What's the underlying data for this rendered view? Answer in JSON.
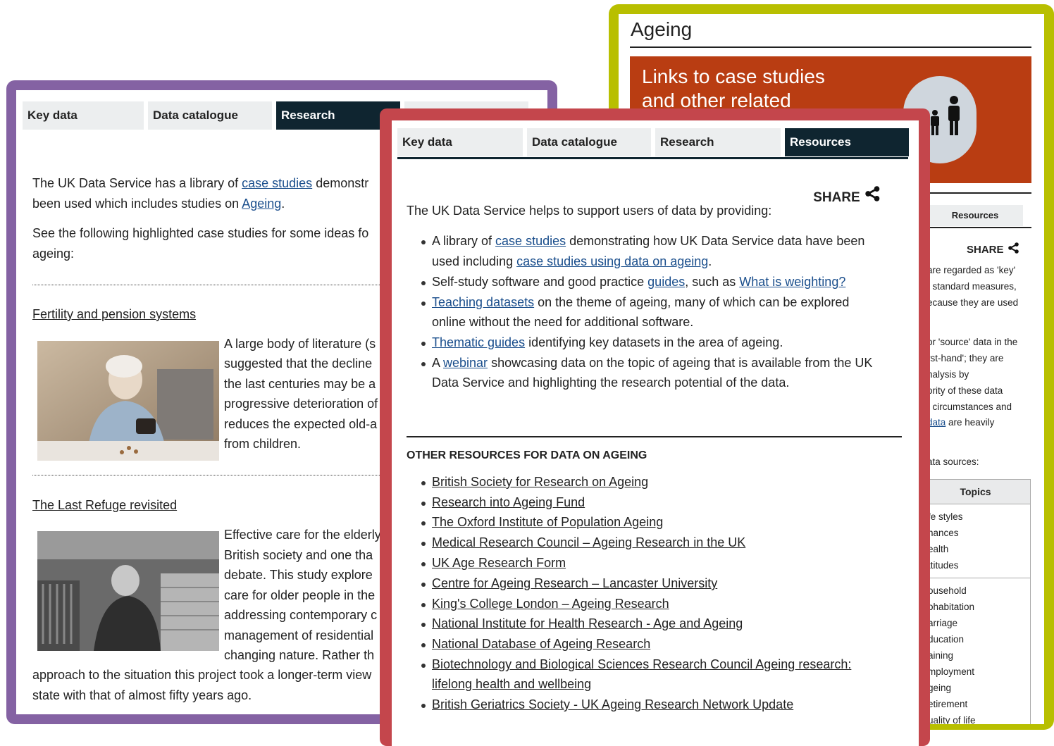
{
  "green_card": {
    "title": "Ageing",
    "banner_line1": "Links to case studies",
    "banner_line2": "and other related",
    "tab_resources": "Resources",
    "share": "SHARE",
    "text_lines": [
      "are regarded as 'key'",
      "f standard measures,",
      "ecause they are used",
      "or 'source' data in the",
      "rst-hand'; they are",
      "nalysis by",
      "ority of these data",
      ", circumstances and",
      "data",
      " are heavily",
      "ata sources:"
    ],
    "table_header": "Topics",
    "group1": [
      "fe styles",
      "nances",
      "ealth",
      "ttitudes"
    ],
    "group2": [
      "ousehold",
      "ohabitation",
      "arriage",
      "ducation",
      "aining",
      "mployment",
      "geing",
      "etirement",
      "uality of life"
    ]
  },
  "purple_card": {
    "tabs": [
      "Key data",
      "Data catalogue",
      "Research",
      ""
    ],
    "intro1_pre": "The UK Data Service has a library of ",
    "intro1_link": "case studies",
    "intro1_post": " demonstr",
    "intro2_pre": "been used which includes studies on ",
    "intro2_link": "Ageing",
    "intro2_post": ".",
    "intro3": "See the following highlighted case studies for some ideas fo",
    "intro4": "ageing:",
    "study1_title": "Fertility and pension systems",
    "study1_lines": [
      "A large body of literature (s",
      "suggested that the decline",
      "the last centuries may be a",
      "progressive deterioration of",
      "reduces the expected old-a",
      "from children."
    ],
    "study2_title": "The Last Refuge revisited",
    "study2_lines": [
      "Effective care for the elderly",
      "British society and one tha",
      "debate. This study explore",
      "care for older people in the",
      "addressing contemporary c",
      "management of residential",
      "changing nature. Rather th"
    ],
    "study2_tail1": "approach to the situation this project took a longer-term view",
    "study2_tail2": "state with that of almost fifty years ago."
  },
  "red_card": {
    "tabs": [
      "Key data",
      "Data catalogue",
      "Research",
      "Resources"
    ],
    "share": "SHARE",
    "intro": "The UK Data Service helps to support users of data by providing:",
    "b1_pre": "A library of ",
    "b1_link": "case studies",
    "b1_post": " demonstrating how UK Data Service data have been",
    "b1_l2_pre": "used including ",
    "b1_l2_link": "case studies using data on ageing",
    "b1_l2_post": ".",
    "b2_pre": "Self-study software and good practice ",
    "b2_link1": "guides",
    "b2_mid": ", such as ",
    "b2_link2": "What is weighting?",
    "b3_link": "Teaching datasets",
    "b3_post": " on the theme of ageing, many of which can be explored",
    "b3_l2": "online without the need for additional software.",
    "b4_link": "Thematic guides",
    "b4_post": " identifying key datasets in the area of ageing.",
    "b5_pre": "A ",
    "b5_link": "webinar",
    "b5_post": " showcasing data on the topic of ageing that is available from the UK",
    "b5_l2": "Data Service and highlighting the research potential of the data.",
    "other_heading": "OTHER RESOURCES FOR DATA ON AGEING",
    "other_links": [
      "British Society for Research on Ageing",
      "Research into Ageing Fund",
      "The Oxford Institute of Population Ageing",
      "Medical Research Council – Ageing Research in the UK",
      "UK Age Research Form",
      "Centre for Ageing Research – Lancaster University",
      "King's College London – Ageing Research",
      "National Institute for Health Research - Age and Ageing",
      "National Database of Ageing Research",
      "Biotechnology and Biological Sciences Research Council Ageing research:",
      "British Geriatrics Society - UK Ageing Research Network Update"
    ],
    "other_link10_line2": "lifelong health and wellbeing"
  }
}
